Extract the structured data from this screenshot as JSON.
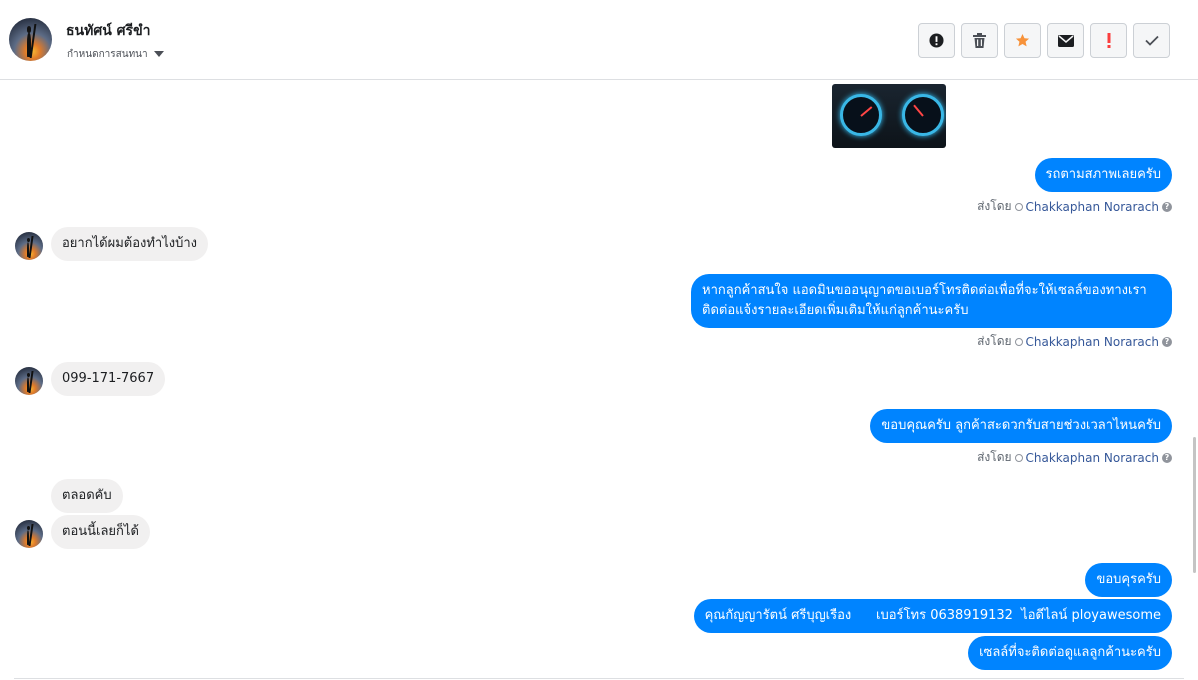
{
  "header": {
    "contact_name": "ธนทัศน์ ศรีขำ",
    "subline": "กำหนดการสนทนา",
    "actions": [
      {
        "name": "spam-button",
        "icon": "exclamation-circle-icon",
        "color": "#1c1e21"
      },
      {
        "name": "delete-button",
        "icon": "trash-icon",
        "color": "#4b4f56"
      },
      {
        "name": "star-button",
        "icon": "star-icon",
        "color": "#f7923a"
      },
      {
        "name": "mark-unread-button",
        "icon": "envelope-icon",
        "color": "#1c1e21"
      },
      {
        "name": "follow-up-button",
        "icon": "exclamation-icon",
        "color": "#fa3e3e"
      },
      {
        "name": "mark-done-button",
        "icon": "checkmark-icon",
        "color": "#4b4f56"
      }
    ]
  },
  "messages": [
    {
      "direction": "out",
      "type": "image",
      "alt": "car dashboard photo"
    },
    {
      "direction": "out",
      "text": "รถตามสภาพเลยครับ"
    },
    {
      "meta": {
        "sent_by_label": "ส่งโดย",
        "agent": "Chakkaphan Norarach"
      }
    },
    {
      "direction": "in",
      "text": "อยากได้ผมต้องทำไงบ้าง"
    },
    {
      "direction": "out",
      "lines": [
        "หากลูกค้าสนใจ แอดมินขออนุญาตขอเบอร์โทรติดต่อเพื่อที่จะให้เซลล์ของทางเรา",
        "ติดต่อแจ้งรายละเอียดเพิ่มเติมให้แก่ลูกค้านะครับ"
      ]
    },
    {
      "meta": {
        "sent_by_label": "ส่งโดย",
        "agent": "Chakkaphan Norarach"
      }
    },
    {
      "direction": "in",
      "text": "099-171-7667"
    },
    {
      "direction": "out",
      "text": "ขอบคุณครับ ลูกค้าสะดวกรับสายช่วงเวลาไหนครับ"
    },
    {
      "meta": {
        "sent_by_label": "ส่งโดย",
        "agent": "Chakkaphan Norarach"
      }
    },
    {
      "direction": "in",
      "text": "ตลอดคับ"
    },
    {
      "direction": "in",
      "text": "ตอนนี้เลยก็ได้"
    },
    {
      "direction": "out",
      "text": "ขอบคุรครับ"
    },
    {
      "direction": "out",
      "text": "คุณกัญญารัตน์ ศรีบุญเรือง      เบอร์โทร 0638919132  ไอดีไลน์ ployawesome"
    },
    {
      "direction": "out",
      "text": "เซลล์ที่จะติดต่อดูแลลูกค้านะครับ"
    }
  ],
  "colors": {
    "outgoing": "#0084ff",
    "incoming": "#f1f0f0",
    "agent_link": "#365899"
  }
}
